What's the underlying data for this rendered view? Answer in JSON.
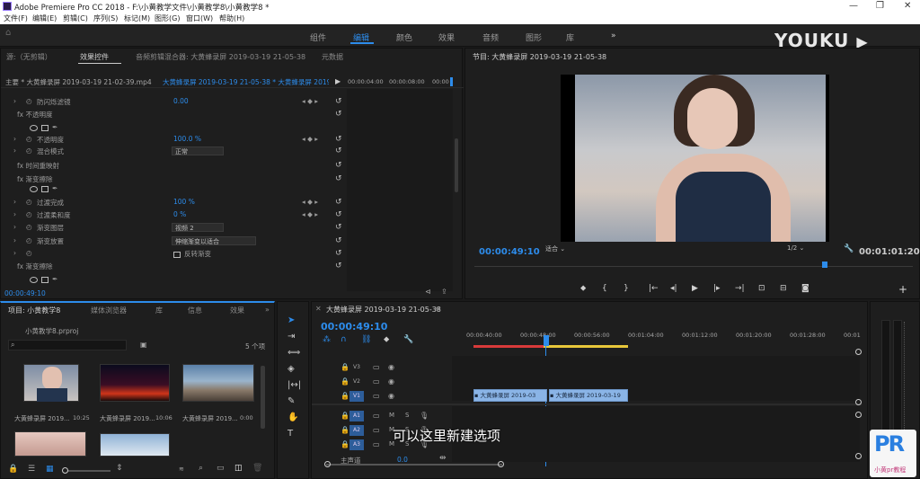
{
  "window": {
    "title": "Adobe Premiere Pro CC 2018 - F:\\小黄教学文件\\小黄教学8\\小黄教学8 *"
  },
  "menu": [
    "文件(F)",
    "编辑(E)",
    "剪辑(C)",
    "序列(S)",
    "标记(M)",
    "图形(G)",
    "窗口(W)",
    "帮助(H)"
  ],
  "workspaces": {
    "items": [
      "组件",
      "编辑",
      "颜色",
      "效果",
      "音频",
      "图形",
      "库"
    ],
    "active_index": 1,
    "more": "»"
  },
  "watermark": {
    "youku": "YOUKU",
    "pr_logo": "PR",
    "pr_caption": "小黄pr教程"
  },
  "source_panel": {
    "tabs": [
      "源:（无剪辑）",
      "效果控件",
      "音频剪辑混合器: 大黄蜂录屏 2019-03-19 21-05-38",
      "元数据"
    ],
    "active_tab": 1,
    "master_label": "主要 * 大黄蜂录屏 2019-03-19 21-02-39.mp4",
    "seq_label": "大黄蜂录屏 2019-03-19 21-05-38 * 大黄蜂录屏 2019-0",
    "ruler": [
      "00:00:04:00",
      "00:00:08:00",
      "00:00"
    ],
    "rows": [
      {
        "indent": 40,
        "text": "防闪烁滤镜",
        "value": "0.00",
        "t": 107
      },
      {
        "indent": 18,
        "text": "fx 不透明度",
        "t": 121
      },
      {
        "indent": 40,
        "text": "不透明度",
        "value": "100.0 %",
        "t": 149
      },
      {
        "indent": 40,
        "text": "混合模式",
        "dd": "正常",
        "t": 162
      },
      {
        "indent": 18,
        "text": "fx 时间重映射",
        "t": 178
      },
      {
        "indent": 18,
        "text": "fx 渐变擦除",
        "t": 193
      },
      {
        "indent": 40,
        "text": "过渡完成",
        "value": "100 %",
        "t": 219
      },
      {
        "indent": 40,
        "text": "过渡柔和度",
        "value": "0 %",
        "t": 233
      },
      {
        "indent": 40,
        "text": "渐变图层",
        "dd": "视频 2",
        "t": 247
      },
      {
        "indent": 40,
        "text": "渐变放置",
        "dd": "伸缩渐变以适合",
        "t": 262
      },
      {
        "indent": 40,
        "text": "",
        "check": "反转渐变",
        "t": 276
      },
      {
        "indent": 18,
        "text": "fx 渐变擦除",
        "t": 290
      }
    ],
    "timecode": "00:00:49:10"
  },
  "program": {
    "title": "节目: 大黄蜂录屏 2019-03-19 21-05-38",
    "timecode": "00:00:49:10",
    "fit": "适合",
    "quality": "1/2",
    "duration": "00:01:01:20",
    "playhead_fraction": 0.8
  },
  "project": {
    "tabs": [
      "项目: 小黄教学8",
      "媒体浏览器",
      "库",
      "信息",
      "效果"
    ],
    "file": "小黄教学8.prproj",
    "count": "5 个项",
    "items": [
      {
        "name": "大黄蜂录屏 2019...",
        "dur": "10:25"
      },
      {
        "name": "大黄蜂录屏 2019...",
        "dur": "10:06"
      },
      {
        "name": "大黄蜂录屏 2019...",
        "dur": "0:00"
      },
      {
        "name": "",
        "dur": ""
      },
      {
        "name": "",
        "dur": ""
      }
    ]
  },
  "timeline": {
    "title": "大黄蜂录屏 2019-03-19 21-05-38",
    "timecode": "00:00:49:10",
    "ruler": [
      "00:00:40:00",
      "00:00:48:00",
      "00:00:56:00",
      "00:01:04:00",
      "00:01:12:00",
      "00:01:20:00",
      "00:01:28:00",
      "00:01"
    ],
    "video_tracks": [
      "V3",
      "V2",
      "V1"
    ],
    "audio_tracks": [
      "A1",
      "A2",
      "A3"
    ],
    "master": "主声道",
    "master_val": "0.0",
    "clip1": "大黄蜂录屏 2019-03",
    "clip2": "大黄蜂录屏 2019-03-19",
    "subtitle": "可以这里新建选项"
  },
  "colors": {
    "accent": "#2d8ceb",
    "panel": "#1e1e1e",
    "clip": "#8ab4e6",
    "workarea": "#e8c73a",
    "redbar": "#d83a3a"
  }
}
